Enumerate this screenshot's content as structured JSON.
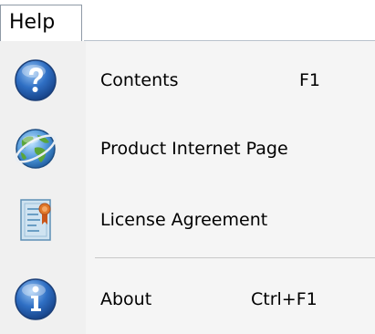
{
  "menubar": {
    "help_label": "Help"
  },
  "menu": {
    "items": [
      {
        "label": "Contents",
        "shortcut": "F1",
        "icon": "help-question-icon"
      },
      {
        "label": "Product Internet Page",
        "shortcut": "",
        "icon": "globe-icon"
      },
      {
        "label": "License Agreement",
        "shortcut": "",
        "icon": "certificate-icon"
      },
      {
        "label": "About",
        "shortcut": "Ctrl+F1",
        "icon": "info-icon"
      }
    ]
  },
  "colors": {
    "gutter": "#f0f0f0",
    "panel": "#f5f5f5",
    "icon_blue": "#2f6fc4",
    "ribbon_orange": "#e0782a"
  }
}
